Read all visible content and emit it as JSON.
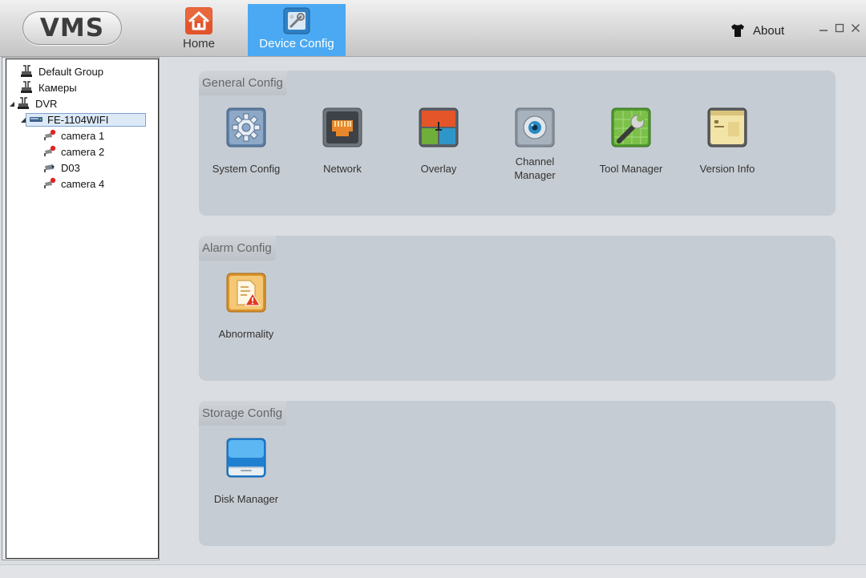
{
  "app": {
    "logo": "VMS"
  },
  "nav": {
    "tabs": [
      {
        "label": "Home",
        "icon": "home-icon",
        "active": false
      },
      {
        "label": "Device Config",
        "icon": "device-config-icon",
        "active": true
      }
    ],
    "about": "About"
  },
  "tree": {
    "items": [
      {
        "label": "Default Group",
        "type": "group"
      },
      {
        "label": "Камеры",
        "type": "group"
      },
      {
        "label": "DVR",
        "type": "group",
        "expanded": true
      },
      {
        "label": "FE-1104WIFI",
        "type": "device",
        "expanded": true,
        "selected": true
      },
      {
        "label": "camera 1",
        "type": "camera",
        "status": "offline"
      },
      {
        "label": "camera 2",
        "type": "camera",
        "status": "offline"
      },
      {
        "label": "D03",
        "type": "camera",
        "status": "online"
      },
      {
        "label": "camera 4",
        "type": "camera",
        "status": "offline"
      }
    ]
  },
  "panels": {
    "general": {
      "title": "General Config",
      "items": [
        {
          "label": "System Config",
          "icon": "gear-icon"
        },
        {
          "label": "Network",
          "icon": "network-port-icon"
        },
        {
          "label": "Overlay",
          "icon": "overlay-icon"
        },
        {
          "label": "Channel\nManager",
          "icon": "camera-lens-icon"
        },
        {
          "label": "Tool Manager",
          "icon": "wrench-icon"
        },
        {
          "label": "Version Info",
          "icon": "version-info-icon"
        }
      ]
    },
    "alarm": {
      "title": "Alarm Config",
      "items": [
        {
          "label": "Abnormality",
          "icon": "warning-document-icon"
        }
      ]
    },
    "storage": {
      "title": "Storage Config",
      "items": [
        {
          "label": "Disk Manager",
          "icon": "disk-icon"
        }
      ]
    }
  },
  "colors": {
    "active_tab": "#4aa9f2",
    "panel": "#c6ccd3",
    "offline_dot": "#e0242b"
  }
}
